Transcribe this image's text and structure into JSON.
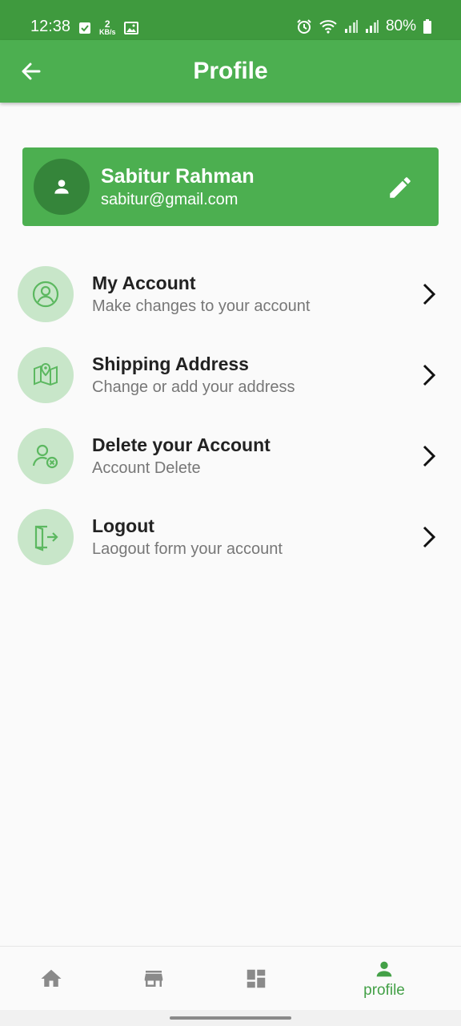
{
  "status_bar": {
    "time": "12:38",
    "net_speed_value": "2",
    "net_speed_unit": "KB/s",
    "battery": "80%",
    "icons": [
      "check-icon",
      "net-speed-icon",
      "image-icon",
      "alarm-icon",
      "wifi-icon",
      "signal-icon",
      "signal-icon",
      "battery-icon"
    ]
  },
  "app_bar": {
    "title": "Profile",
    "back_icon": "arrow-left-icon"
  },
  "profile": {
    "name": "Sabitur Rahman",
    "email": "sabitur@gmail.com",
    "avatar_icon": "person-icon",
    "edit_icon": "pencil-icon"
  },
  "menu": {
    "items": [
      {
        "title": "My Account",
        "subtitle": "Make changes to your account",
        "icon": "user-circle-icon"
      },
      {
        "title": "Shipping Address",
        "subtitle": "Change or add your address",
        "icon": "map-pin-icon"
      },
      {
        "title": "Delete your Account",
        "subtitle": "Account Delete",
        "icon": "user-delete-icon"
      },
      {
        "title": "Logout",
        "subtitle": "Laogout form your account",
        "icon": "logout-icon"
      }
    ]
  },
  "bottom_nav": {
    "items": [
      {
        "icon": "home-icon",
        "label": "",
        "active": false
      },
      {
        "icon": "store-icon",
        "label": "",
        "active": false
      },
      {
        "icon": "dashboard-icon",
        "label": "",
        "active": false
      },
      {
        "icon": "person-icon",
        "label": "profile",
        "active": true
      }
    ]
  },
  "colors": {
    "status_bar": "#3f9a3e",
    "primary": "#4caf50",
    "avatar_bg": "#35853a",
    "icon_circle": "#c8e6c9",
    "icon_stroke": "#5cb860",
    "nav_active": "#43a047",
    "nav_inactive": "#8a8a8a"
  }
}
